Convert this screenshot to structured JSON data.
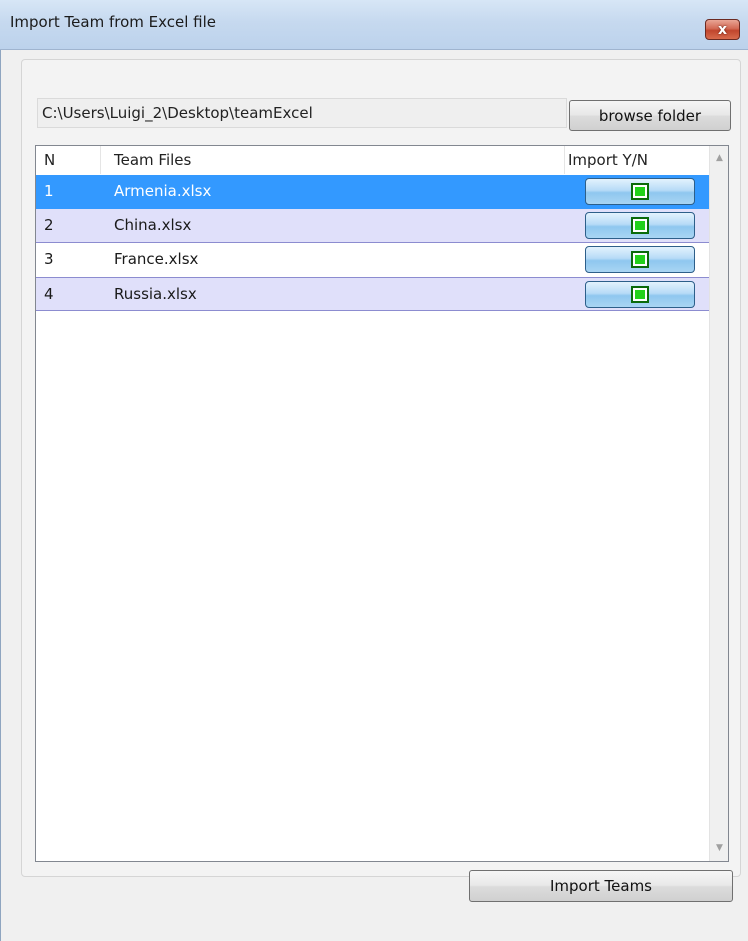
{
  "window": {
    "title": "Import Team from Excel file",
    "close_label": "x"
  },
  "folder": {
    "path": "C:\\Users\\Luigi_2\\Desktop\\teamExcel",
    "browse_label": "browse folder"
  },
  "table": {
    "columns": [
      "N",
      "Team Files",
      "Import Y/N"
    ],
    "rows": [
      {
        "n": "1",
        "file": "Armenia.xlsx",
        "import": true
      },
      {
        "n": "2",
        "file": "China.xlsx",
        "import": true
      },
      {
        "n": "3",
        "file": "France.xlsx",
        "import": true
      },
      {
        "n": "4",
        "file": "Russia.xlsx",
        "import": true
      }
    ],
    "selected_row": 1
  },
  "actions": {
    "import_label": "Import Teams"
  },
  "colors": {
    "selection": "#3399ff",
    "alt_row": "#e0e0fa",
    "check_green": "#22d11a",
    "toggle_blue": "#8fc7ef"
  }
}
